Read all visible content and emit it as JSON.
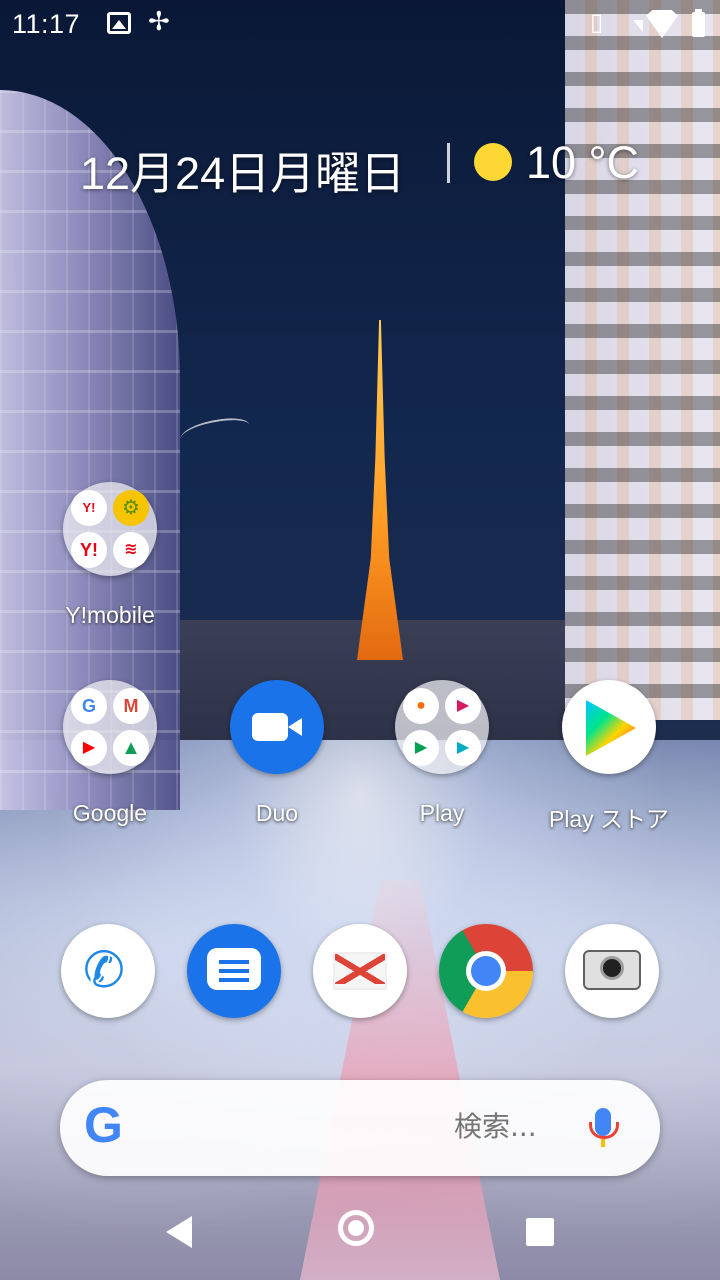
{
  "status_bar": {
    "time": "11:17",
    "icons": [
      "image-notification-icon",
      "fan-icon",
      "vibrate-icon",
      "signal-icon",
      "wifi-icon",
      "battery-icon"
    ]
  },
  "glance": {
    "date": "12月24日月曜日",
    "temperature": "10 °C",
    "weather_icon": "sun-icon"
  },
  "apps": [
    {
      "label": "Y!mobile",
      "type": "folder",
      "icons": [
        "yahoo-japan-icon",
        "settings-app-icon",
        "yahoo-icon",
        "wifi-app-icon"
      ]
    },
    {
      "label": "Google",
      "type": "folder",
      "icons": [
        "google-icon",
        "gmail-icon",
        "youtube-icon",
        "drive-icon"
      ]
    },
    {
      "label": "Duo",
      "type": "app"
    },
    {
      "label": "Play",
      "type": "folder",
      "icons": [
        "play-music-icon",
        "play-books-icon",
        "play-games-icon",
        "play-movies-icon"
      ]
    },
    {
      "label": "Play ストア",
      "type": "app"
    }
  ],
  "dock": [
    "phone-icon",
    "messages-icon",
    "gmail-icon",
    "chrome-icon",
    "camera-icon"
  ],
  "search": {
    "placeholder": "検索..."
  },
  "colors": {
    "duo_blue": "#1a73e8",
    "google_blue": "#4285f4",
    "google_red": "#ea4335",
    "google_yellow": "#fbbc05",
    "google_green": "#34a853"
  }
}
